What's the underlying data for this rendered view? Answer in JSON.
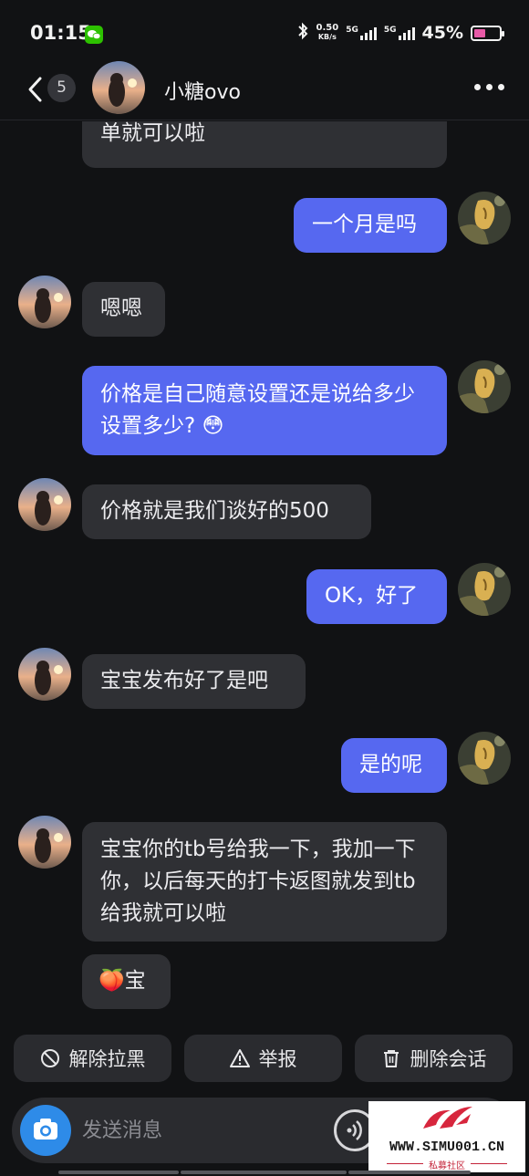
{
  "status_bar": {
    "time": "01:15",
    "speed_value": "0.50",
    "speed_unit": "KB/s",
    "net1": "5G",
    "net2": "5G",
    "battery": "45%",
    "battery_level": 0.45,
    "icons": [
      "wechat-icon",
      "bluetooth-icon",
      "signal-icon",
      "battery-icon"
    ]
  },
  "header": {
    "unread_count": "5",
    "title": "小糖ovo",
    "icons": [
      "back-icon",
      "more-icon"
    ]
  },
  "messages": [
    {
      "side": "in",
      "text": "单就可以啦"
    },
    {
      "side": "out",
      "text": "一个月是吗"
    },
    {
      "side": "in",
      "text": "嗯嗯"
    },
    {
      "side": "out",
      "text": "价格是自己随意设置还是说给多少设置多少?",
      "emoji": "😳"
    },
    {
      "side": "in",
      "text": "价格就是我们谈好的500"
    },
    {
      "side": "out",
      "text": "OK，好了"
    },
    {
      "side": "in",
      "text": "宝宝发布好了是吧"
    },
    {
      "side": "out",
      "text": "是的呢"
    },
    {
      "side": "in",
      "text": "宝宝你的tb号给我一下，我加一下你，以后每天的打卡返图就发到tb给我就可以啦"
    },
    {
      "side": "in",
      "text": "宝",
      "emoji": "🍑"
    }
  ],
  "actions": {
    "unblock": "解除拉黑",
    "report": "举报",
    "delete": "删除会话"
  },
  "input": {
    "placeholder": "发送消息"
  },
  "watermark": {
    "site": "WWW.SIMU001.CN",
    "sub": "私募社区"
  },
  "colors": {
    "background": "#111214",
    "incoming_bubble": "#2f3034",
    "outgoing_bubble": "#5668f0",
    "camera_button": "#2e8be8"
  }
}
